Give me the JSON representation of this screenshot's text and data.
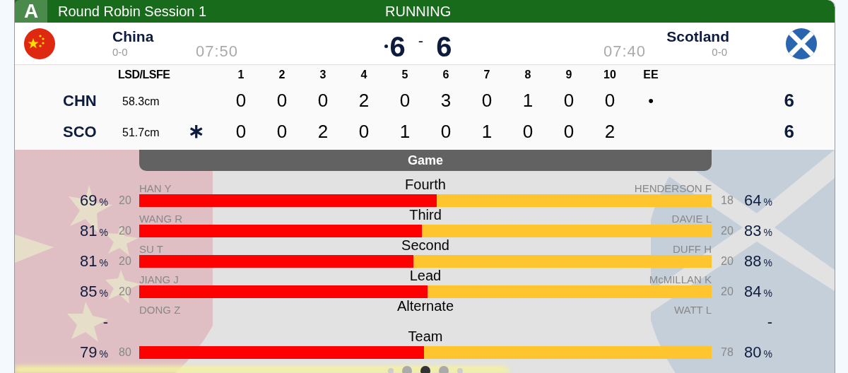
{
  "header": {
    "badge": "A",
    "title": "Round Robin Session 1",
    "status": "RUNNING"
  },
  "teams": [
    {
      "name": "China",
      "record": "0-0",
      "clock": "07:50",
      "score": "6",
      "hammer": true,
      "kind": "china"
    },
    {
      "name": "Scotland",
      "record": "0-0",
      "clock": "07:40",
      "score": "6",
      "hammer": false,
      "kind": "scotland"
    }
  ],
  "score_separator": "-",
  "linescore": {
    "lsd_header": "LSD/LSFE",
    "ends": [
      "1",
      "2",
      "3",
      "4",
      "5",
      "6",
      "7",
      "8",
      "9",
      "10"
    ],
    "extra_end": "EE",
    "rows": [
      {
        "team": "CHN",
        "lsd": "58.3cm",
        "ends": [
          "0",
          "0",
          "0",
          "2",
          "0",
          "3",
          "0",
          "1",
          "0",
          "0"
        ],
        "extra_end": "•",
        "total": "6"
      },
      {
        "team": "SCO",
        "lsd": "51.7cm",
        "lsfe_mark": "∗",
        "ends": [
          "0",
          "0",
          "2",
          "0",
          "1",
          "0",
          "1",
          "0",
          "0",
          "2"
        ],
        "total": "6"
      }
    ]
  },
  "game": {
    "title": "Game",
    "rows": [
      {
        "position": "Fourth",
        "left": {
          "player": "HAN Y",
          "count": "20",
          "pct": "69",
          "unit": "%"
        },
        "right": {
          "player": "HENDERSON F",
          "count": "18",
          "pct": "64",
          "unit": "%"
        },
        "level": 0.52
      },
      {
        "position": "Third",
        "left": {
          "player": "WANG R",
          "count": "20",
          "pct": "81",
          "unit": "%"
        },
        "right": {
          "player": "DAVIE L",
          "count": "20",
          "pct": "83",
          "unit": "%"
        },
        "level": 0.494
      },
      {
        "position": "Second",
        "left": {
          "player": "SU T",
          "count": "20",
          "pct": "81",
          "unit": "%"
        },
        "right": {
          "player": "DUFF H",
          "count": "20",
          "pct": "88",
          "unit": "%"
        },
        "level": 0.479
      },
      {
        "position": "Lead",
        "left": {
          "player": "JIANG J",
          "count": "20",
          "pct": "85",
          "unit": "%"
        },
        "right": {
          "player": "McMILLAN K",
          "count": "20",
          "pct": "84",
          "unit": "%"
        },
        "level": 0.504
      },
      {
        "position": "Alternate",
        "left": {
          "player": "DONG Z",
          "pct": "-"
        },
        "right": {
          "player": "WATT L",
          "pct": "-"
        }
      },
      {
        "position": "Team",
        "left": {
          "count": "80",
          "pct": "79",
          "unit": "%"
        },
        "right": {
          "count": "78",
          "pct": "80",
          "unit": "%"
        },
        "level": 0.498
      }
    ]
  },
  "pagination": [
    {
      "selected": false
    },
    {
      "selected": false
    },
    {
      "selected": true
    },
    {
      "selected": false
    },
    {
      "selected": false
    }
  ]
}
